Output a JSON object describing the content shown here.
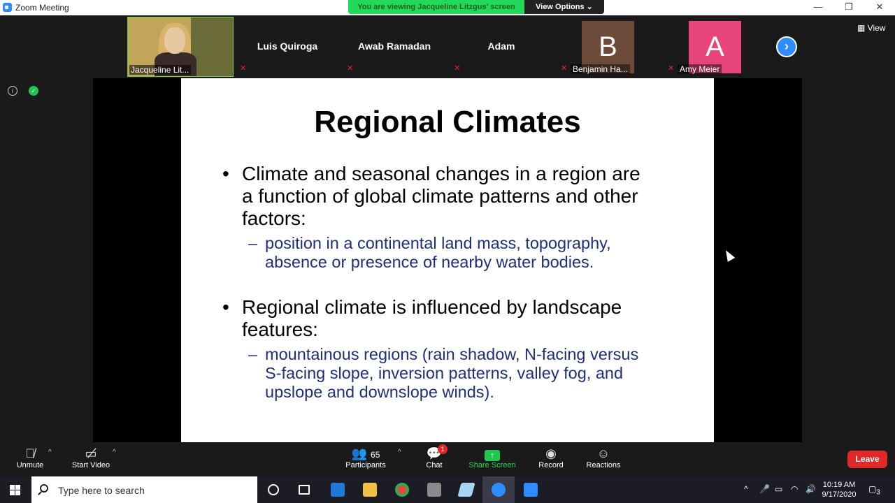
{
  "window": {
    "title": "Zoom Meeting",
    "minimize": "—",
    "restore": "❐",
    "close": "✕"
  },
  "banner": {
    "viewing": "You are viewing Jacqueline Litzgus' screen",
    "view_options": "View Options ⌄"
  },
  "participants_strip": [
    {
      "name": "Jacqueline Lit...",
      "video": true
    },
    {
      "name": "Luis Quiroga"
    },
    {
      "name": "Awab Ramadan"
    },
    {
      "name": "Adam"
    },
    {
      "name": "Benjamin Ha...",
      "initial": "B",
      "color": "#6b4a3a"
    },
    {
      "name": "Amy Meier",
      "initial": "A",
      "color": "#e8457b"
    }
  ],
  "view_button": "View",
  "slide": {
    "title": "Regional Climates",
    "bullet1": {
      "line1": "Climate and seasonal changes in a region are",
      "line2": "a function of global climate patterns and other",
      "line3": "factors:"
    },
    "sub1": {
      "line1": "position in a continental land mass, topography,",
      "line2": "absence or presence of nearby water bodies."
    },
    "bullet2": {
      "line1": "Regional climate is influenced by landscape",
      "line2": "features:"
    },
    "sub2": {
      "line1": "mountainous regions (rain shadow, N-facing versus",
      "line2": "S-facing slope, inversion patterns, valley fog, and",
      "line3": "upslope and downslope winds)."
    },
    "bullet_symbol": "•",
    "dash_symbol": "–"
  },
  "toolbar": {
    "unmute": "Unmute",
    "start_video": "Start Video",
    "participants": "Participants",
    "participants_count": "65",
    "chat": "Chat",
    "chat_badge": "1",
    "share_screen": "Share Screen",
    "record": "Record",
    "reactions": "Reactions",
    "leave": "Leave"
  },
  "taskbar": {
    "search_placeholder": "Type here to search",
    "time": "10:19 AM",
    "date": "9/17/2020",
    "notification_count": "3"
  },
  "colors": {
    "accent": "#2d8cff",
    "green": "#23d959",
    "leave_red": "#e02828",
    "slide_sub_text": "#1f2f78"
  }
}
